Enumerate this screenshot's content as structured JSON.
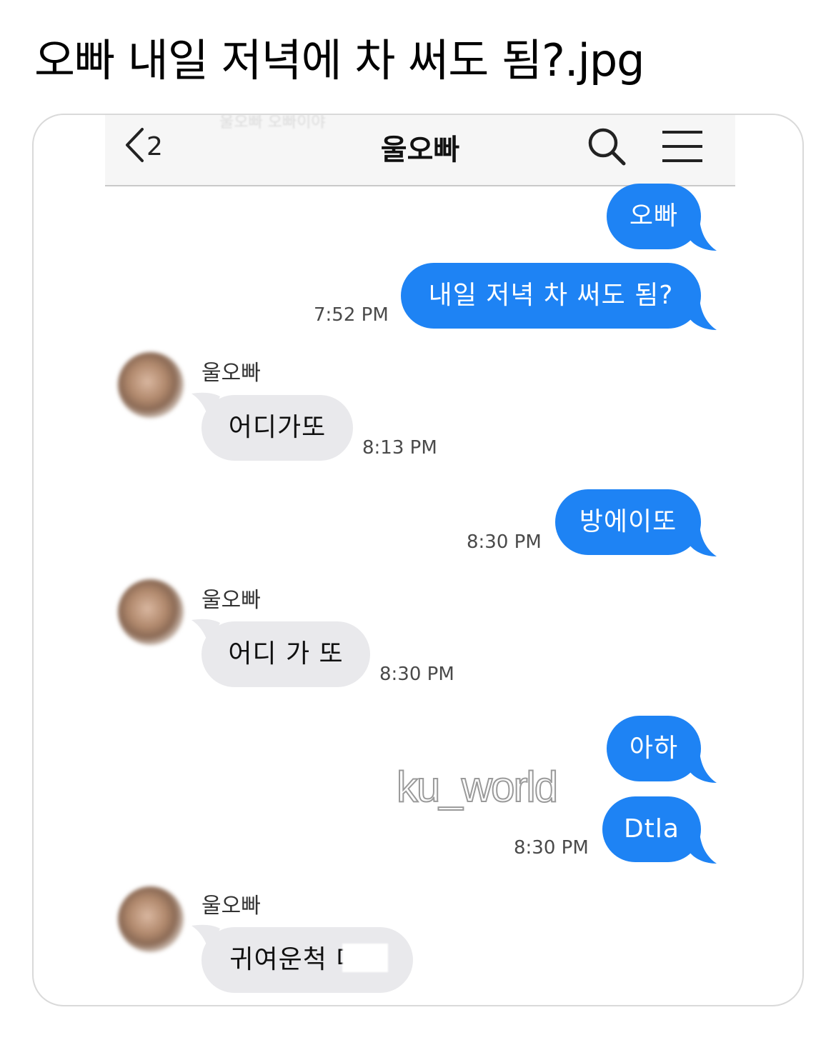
{
  "post": {
    "title": "오빠 내일 저녁에 차 써도 됨?.jpg"
  },
  "chat": {
    "header": {
      "ghost_text": "울오빠 오빠이야",
      "back_count": "2",
      "title": "울오빠",
      "icons": [
        "chevron-left-icon",
        "search-icon",
        "menu-icon"
      ]
    },
    "messages": [
      {
        "side": "out",
        "text": "오빠",
        "time": ""
      },
      {
        "side": "out",
        "text": "내일 저녁 차 써도 됨?",
        "time": "7:52 PM"
      },
      {
        "side": "in",
        "sender": "울오빠",
        "text": "어디가또",
        "time": "8:13 PM"
      },
      {
        "side": "out",
        "text": "방에이또",
        "time": "8:30 PM"
      },
      {
        "side": "in",
        "sender": "울오빠",
        "text": "어디 가 또",
        "time": "8:30 PM"
      },
      {
        "side": "out",
        "text": "아하",
        "time": ""
      },
      {
        "side": "out",
        "text": "Dtla",
        "time": "8:30 PM"
      },
      {
        "side": "in",
        "sender": "울오빠",
        "text": "귀여운척 다해",
        "time": ""
      }
    ],
    "watermark": "ku_world",
    "colors": {
      "outgoing_bubble": "#1e83f4",
      "incoming_bubble": "#e9e9ec",
      "navbar_bg": "#f6f6f6"
    }
  }
}
